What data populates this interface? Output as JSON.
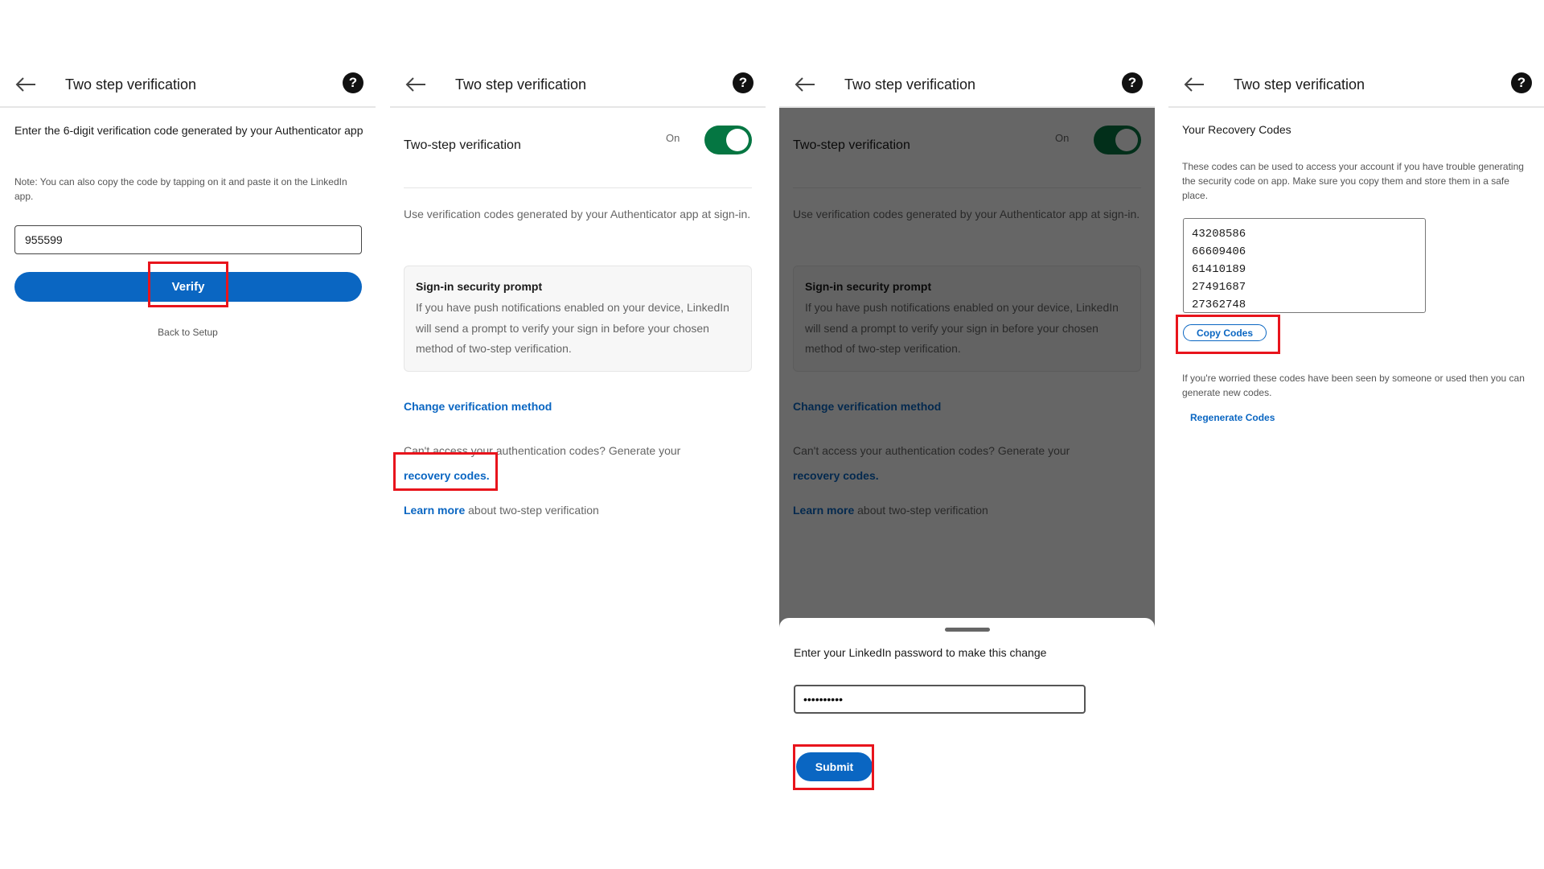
{
  "header": {
    "title": "Two step verification"
  },
  "screen1": {
    "instruction": "Enter the 6-digit verification code generated by your Authenticator app",
    "note": "Note: You can also copy the code by tapping on it and paste it on the LinkedIn app.",
    "code_value": "955599",
    "verify_label": "Verify",
    "back_to_setup": "Back to Setup"
  },
  "screen2": {
    "toggle_label": "Two-step verification",
    "toggle_state": "On",
    "use_codes_text": "Use verification codes generated by your Authenticator app at sign-in.",
    "prompt_title": "Sign-in security prompt",
    "prompt_body": "If you have push notifications enabled on your device, LinkedIn will send a prompt to verify your sign in before your chosen method of two-step verification.",
    "change_method": "Change verification method",
    "cant_access": "Can't access your authentication codes? Generate your",
    "recovery_codes_link": "recovery codes.",
    "learn_more_link": "Learn more",
    "learn_more_rest": " about two-step verification"
  },
  "screen3": {
    "password_prompt": "Enter your LinkedIn password to make this change",
    "password_value": "••••••••••",
    "submit_label": "Submit"
  },
  "screen4": {
    "title": "Your Recovery Codes",
    "description": "These codes can be used to access your account if you have trouble generating the security code on app. Make sure you copy them and store them in a safe place.",
    "codes": [
      "43208586",
      "66609406",
      "61410189",
      "27491687",
      "27362748"
    ],
    "copy_label": "Copy Codes",
    "worried_text": "If you're worried these codes have been seen by someone or used then you can generate new codes.",
    "regenerate_label": "Regenerate Codes"
  },
  "icons": {
    "back": "arrow-left-icon",
    "help": "question-circle-icon"
  },
  "colors": {
    "accent": "#0a66c2",
    "toggle_on": "#057642",
    "highlight": "#e8141c"
  }
}
